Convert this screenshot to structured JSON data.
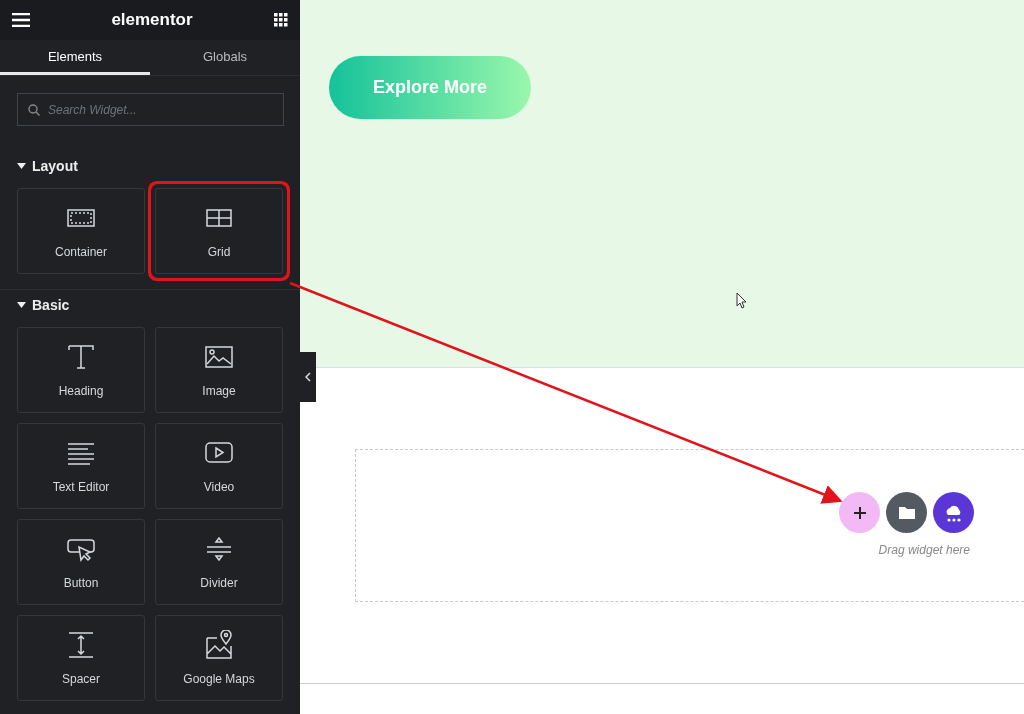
{
  "panel": {
    "logo": "elementor",
    "tabs": [
      {
        "label": "Elements",
        "selected": true
      },
      {
        "label": "Globals",
        "selected": false
      }
    ],
    "search": {
      "placeholder": "Search Widget..."
    },
    "sections": [
      {
        "title": "Layout",
        "expanded": true,
        "widgets": [
          {
            "label": "Container",
            "kind": "container",
            "highlighted": false
          },
          {
            "label": "Grid",
            "kind": "grid",
            "highlighted": true
          }
        ]
      },
      {
        "title": "Basic",
        "expanded": true,
        "widgets": [
          {
            "label": "Heading",
            "kind": "heading",
            "highlighted": false
          },
          {
            "label": "Image",
            "kind": "image",
            "highlighted": false
          },
          {
            "label": "Text Editor",
            "kind": "text",
            "highlighted": false
          },
          {
            "label": "Video",
            "kind": "video",
            "highlighted": false
          },
          {
            "label": "Button",
            "kind": "button",
            "highlighted": false
          },
          {
            "label": "Divider",
            "kind": "divider",
            "highlighted": false
          },
          {
            "label": "Spacer",
            "kind": "spacer",
            "highlighted": false
          },
          {
            "label": "Google Maps",
            "kind": "map",
            "highlighted": false
          }
        ]
      }
    ]
  },
  "canvas": {
    "hero_button": "Explore More",
    "drop_zone": {
      "hint": "Drag widget here"
    }
  }
}
